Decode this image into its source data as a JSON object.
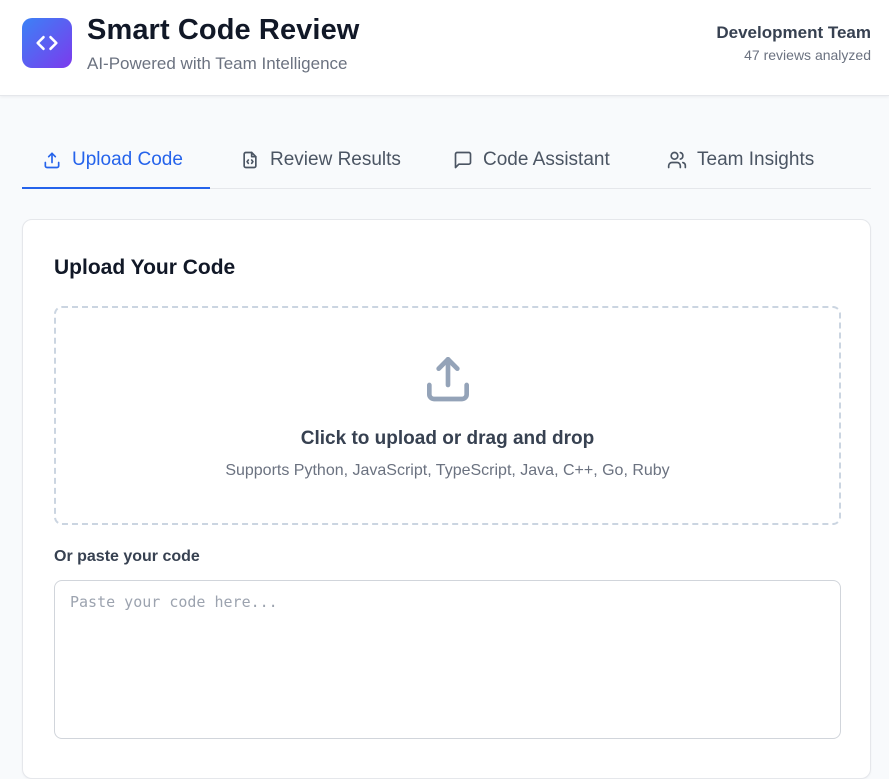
{
  "header": {
    "title": "Smart Code Review",
    "subtitle": "AI-Powered with Team Intelligence",
    "team_name": "Development Team",
    "team_meta": "47 reviews analyzed",
    "logo_icon": "code-brackets-icon",
    "brand_gradient": [
      "#3b82f6",
      "#7c3aed"
    ]
  },
  "tabs": [
    {
      "label": "Upload Code",
      "icon": "upload-icon",
      "active": true
    },
    {
      "label": "Review Results",
      "icon": "file-code-icon",
      "active": false
    },
    {
      "label": "Code Assistant",
      "icon": "chat-bubble-icon",
      "active": false
    },
    {
      "label": "Team Insights",
      "icon": "users-icon",
      "active": false
    }
  ],
  "upload": {
    "title": "Upload Your Code",
    "dropzone_title": "Click to upload or drag and drop",
    "dropzone_subtitle": "Supports Python, JavaScript, TypeScript, Java, C++, Go, Ruby",
    "paste_label": "Or paste your code",
    "paste_placeholder": "Paste your code here...",
    "paste_value": ""
  },
  "colors": {
    "accent": "#2563eb",
    "border": "#e5e7eb",
    "muted_text": "#6b7280"
  }
}
